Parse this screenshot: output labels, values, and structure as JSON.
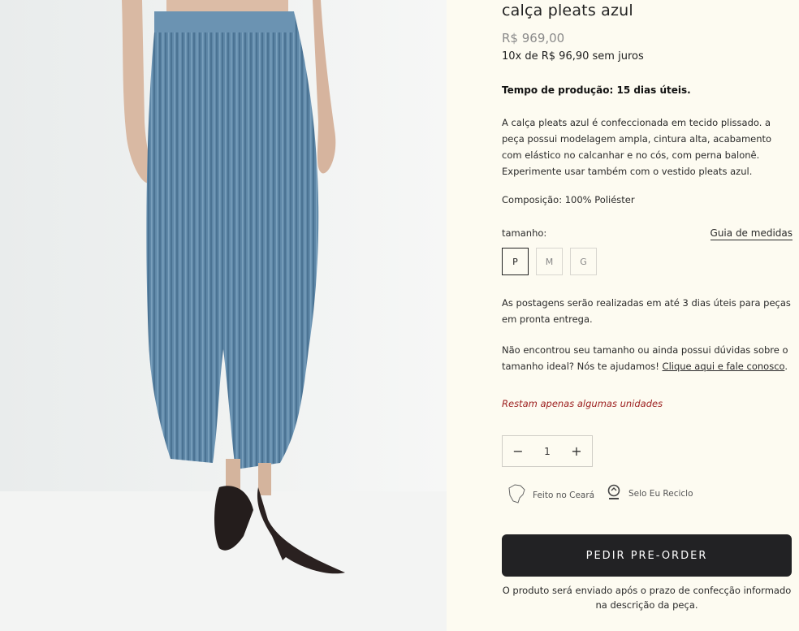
{
  "product": {
    "title": "calça pleats azul",
    "price": "R$ 969,00",
    "installments": "10x de R$ 96,90 sem juros",
    "production_time": "Tempo de produção: 15 dias úteis.",
    "description": "A calça pleats azul é confeccionada em tecido plissado. a peça possui modelagem ampla, cintura alta, acabamento com elástico no calcanhar e no cós, com perna balonê. Experimente usar também com o vestido pleats azul.",
    "composition": "Composição: 100% Poliéster"
  },
  "sizes": {
    "label": "tamanho:",
    "guide_link": "Guia de medidas",
    "options": [
      "P",
      "M",
      "G"
    ],
    "selected": "P"
  },
  "shipping_note": "As postagens serão realizadas em até 3 dias úteis para peças em pronta entrega.",
  "help": {
    "text": "Não encontrou seu tamanho ou ainda possui dúvidas sobre o tamanho ideal? Nós te ajudamos! ",
    "link": "Clique aqui e fale conosco",
    "suffix": "."
  },
  "stock_warning": "Restam apenas algumas unidades",
  "quantity": {
    "value": "1",
    "minus": "−",
    "plus": "+"
  },
  "badges": {
    "ceara": "Feito no Ceará",
    "recicle": "Selo Eu Reciclo"
  },
  "cta": {
    "label": "PEDIR PRE-ORDER",
    "note": "O produto será enviado após o prazo de confecção informado na descrição da peça."
  },
  "icons": {
    "ceara": "ceara-map-icon",
    "recicle": "recycle-seal-icon"
  }
}
